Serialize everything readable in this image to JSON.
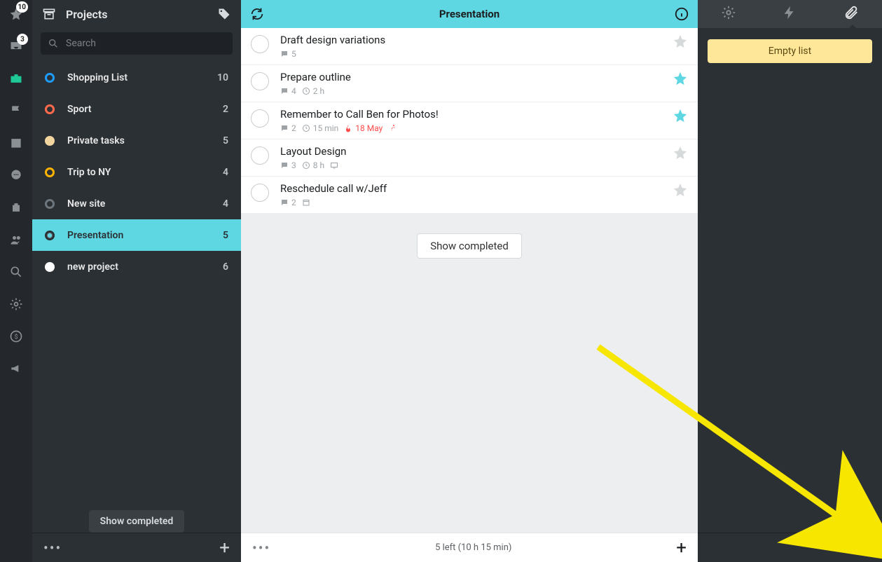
{
  "rail": {
    "star_badge": "10",
    "inbox_badge": "3"
  },
  "sidebar": {
    "title": "Projects",
    "search_placeholder": "Search",
    "show_completed_label": "Show completed",
    "projects": [
      {
        "name": "Shopping List",
        "count": "10",
        "color": "#1f9cff",
        "style": "ring",
        "selected": false
      },
      {
        "name": "Sport",
        "count": "2",
        "color": "#ff6a4d",
        "style": "ring",
        "selected": false
      },
      {
        "name": "Private tasks",
        "count": "5",
        "color": "#f2d59f",
        "style": "fill",
        "selected": false
      },
      {
        "name": "Trip to NY",
        "count": "4",
        "color": "#ffb300",
        "style": "ring",
        "selected": false
      },
      {
        "name": "New site",
        "count": "4",
        "color": "#6d767d",
        "style": "ring",
        "selected": false
      },
      {
        "name": "Presentation",
        "count": "5",
        "color": "#2b3034",
        "style": "ring-dark",
        "selected": true
      },
      {
        "name": "new project",
        "count": "6",
        "color": "#ffffff",
        "style": "fill",
        "selected": false
      }
    ]
  },
  "main": {
    "title": "Presentation",
    "show_completed_label": "Show completed",
    "status": "5 left (10 h 15 min)",
    "tasks": [
      {
        "title": "Draft design variations",
        "comments": "5",
        "duration": "",
        "due": "",
        "due_hot": false,
        "screen": false,
        "running": false,
        "starred": false
      },
      {
        "title": "Prepare outline",
        "comments": "4",
        "duration": "2 h",
        "due": "",
        "due_hot": false,
        "screen": false,
        "running": false,
        "starred": true
      },
      {
        "title": "Remember to Call Ben for Photos!",
        "comments": "2",
        "duration": "15 min",
        "due": "18 May",
        "due_hot": true,
        "screen": false,
        "running": true,
        "starred": true
      },
      {
        "title": "Layout Design",
        "comments": "3",
        "duration": "8 h",
        "due": "",
        "due_hot": false,
        "screen": true,
        "running": false,
        "starred": false
      },
      {
        "title": "Reschedule call w/Jeff",
        "comments": "2",
        "duration": "",
        "due": "",
        "due_hot": false,
        "screen": false,
        "running": false,
        "starred": false,
        "calendar": true
      }
    ]
  },
  "right": {
    "empty_label": "Empty list"
  }
}
